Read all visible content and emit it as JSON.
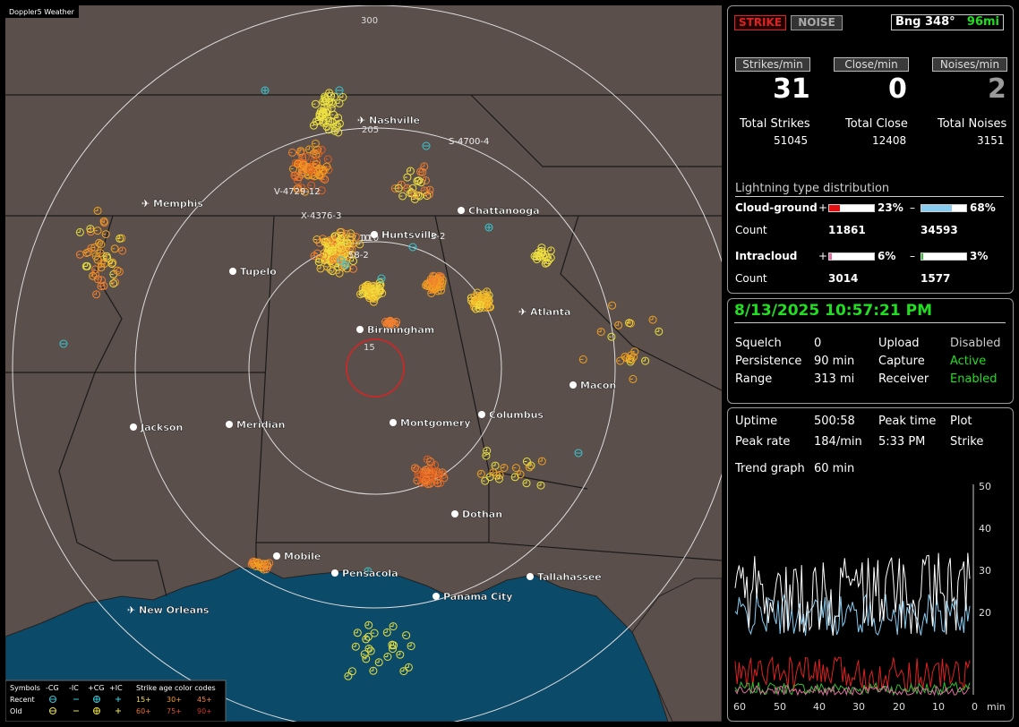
{
  "map": {
    "title_tag": "Doppler5 Weather",
    "range_labels": [
      "300",
      "205",
      "110",
      "15"
    ],
    "cities": [
      {
        "name": "Nashville",
        "kind": "airport"
      },
      {
        "name": "Memphis",
        "kind": "airport"
      },
      {
        "name": "Chattanooga",
        "kind": "city"
      },
      {
        "name": "Huntsville",
        "kind": "city"
      },
      {
        "name": "Tupelo",
        "kind": "city"
      },
      {
        "name": "Birmingham",
        "kind": "city"
      },
      {
        "name": "Atlanta",
        "kind": "airport"
      },
      {
        "name": "Macon",
        "kind": "city"
      },
      {
        "name": "Jackson",
        "kind": "city"
      },
      {
        "name": "Meridian",
        "kind": "city"
      },
      {
        "name": "Montgomery",
        "kind": "city"
      },
      {
        "name": "Columbus",
        "kind": "city"
      },
      {
        "name": "Dothan",
        "kind": "city"
      },
      {
        "name": "Mobile",
        "kind": "city"
      },
      {
        "name": "Pensacola",
        "kind": "city"
      },
      {
        "name": "Tallahassee",
        "kind": "city"
      },
      {
        "name": "Panama City",
        "kind": "city"
      },
      {
        "name": "New Orleans",
        "kind": "airport"
      }
    ],
    "storm_labels": [
      "S-4700-4",
      "V-4729-12",
      "X-4376-3",
      "3-2",
      "58-2",
      "10"
    ],
    "legend": {
      "symbols_header": "Symbols",
      "col_neg_cg": "-CG",
      "col_neg_ic": "-IC",
      "col_pos_cg": "+CG",
      "col_pos_ic": "+IC",
      "age_header": "Strike age color codes",
      "recent_label": "Recent",
      "old_label": "Old",
      "recent_ages": [
        "15+",
        "30+",
        "45+"
      ],
      "old_ages": [
        "60+",
        "75+",
        "90+"
      ]
    }
  },
  "top_panel": {
    "strike_btn": "STRIKE",
    "noise_btn": "NOISE",
    "bearing": "Bng 348°",
    "range_mi": "96mi",
    "strikes_per_min_label": "Strikes/min",
    "close_per_min_label": "Close/min",
    "noises_per_min_label": "Noises/min",
    "strikes_per_min": "31",
    "close_per_min": "0",
    "noises_per_min": "2",
    "total_strikes_label": "Total Strikes",
    "total_close_label": "Total Close",
    "total_noises_label": "Total Noises",
    "total_strikes": "51045",
    "total_close": "12408",
    "total_noises": "3151",
    "dist_title": "Lightning type distribution",
    "cg_label": "Cloud-ground",
    "ic_label": "Intracloud",
    "plus": "+",
    "minus": "–",
    "count_label": "Count",
    "cg_pos_pct": "23%",
    "cg_neg_pct": "68%",
    "cg_pos_count": "11861",
    "cg_neg_count": "34593",
    "ic_pos_pct": "6%",
    "ic_neg_pct": "3%",
    "ic_pos_count": "3014",
    "ic_neg_count": "1577",
    "cg_pos_frac": 0.23,
    "cg_neg_frac": 0.68,
    "ic_pos_frac": 0.06,
    "ic_neg_frac": 0.03
  },
  "status_panel": {
    "datetime": "8/13/2025 10:57:21 PM",
    "squelch_label": "Squelch",
    "squelch": "0",
    "persistence_label": "Persistence",
    "persistence": "90 min",
    "range_label": "Range",
    "range": "313 mi",
    "upload_label": "Upload",
    "upload": "Disabled",
    "capture_label": "Capture",
    "capture": "Active",
    "receiver_label": "Receiver",
    "receiver": "Enabled"
  },
  "trend_panel": {
    "uptime_label": "Uptime",
    "uptime": "500:58",
    "peak_time_label": "Peak time",
    "peak_time": "5:33 PM",
    "plot_label": "Plot",
    "plot": "Strike",
    "peak_rate_label": "Peak rate",
    "peak_rate": "184/min",
    "trend_label": "Trend graph",
    "trend_value": "60 min",
    "y_ticks": [
      "50",
      "40",
      "30",
      "20"
    ],
    "x_ticks": [
      "60",
      "50",
      "40",
      "30",
      "20",
      "10",
      "0"
    ],
    "x_unit": "min"
  },
  "chart_data": {
    "type": "line",
    "ylim": [
      0,
      50
    ],
    "xlim": [
      60,
      0
    ],
    "series": []
  },
  "colors": {
    "map_land": "#5a4f4a",
    "map_water": "#0c4a6a",
    "strike_btn": "#dd2222",
    "bearing_green": "#22dd22",
    "active_green": "#22dd22"
  }
}
